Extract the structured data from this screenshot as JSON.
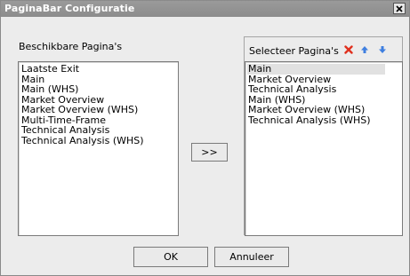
{
  "window": {
    "title": "PaginaBar Configuratie"
  },
  "available": {
    "label": "Beschikbare Pagina's",
    "items": [
      "Laatste Exit",
      "Main",
      "Main (WHS)",
      "Market Overview",
      "Market Overview (WHS)",
      "Multi-Time-Frame",
      "Technical Analysis",
      "Technical Analysis (WHS)"
    ]
  },
  "transfer": {
    "label": ">>"
  },
  "selected": {
    "label": "Selecteer Pagina's",
    "items": [
      "Main",
      "Market Overview",
      "Technical Analysis",
      "Main (WHS)",
      "Market Overview (WHS)",
      "Technical Analysis (WHS)"
    ],
    "selected_item": "Main",
    "tools": [
      "delete-icon",
      "move-up-icon",
      "move-down-icon"
    ]
  },
  "footer": {
    "ok_label": "OK",
    "cancel_label": "Annuleer"
  },
  "colors": {
    "titlebar": "#8f8f8f",
    "delete": "#e0301e",
    "arrows": "#3f7fe0"
  }
}
